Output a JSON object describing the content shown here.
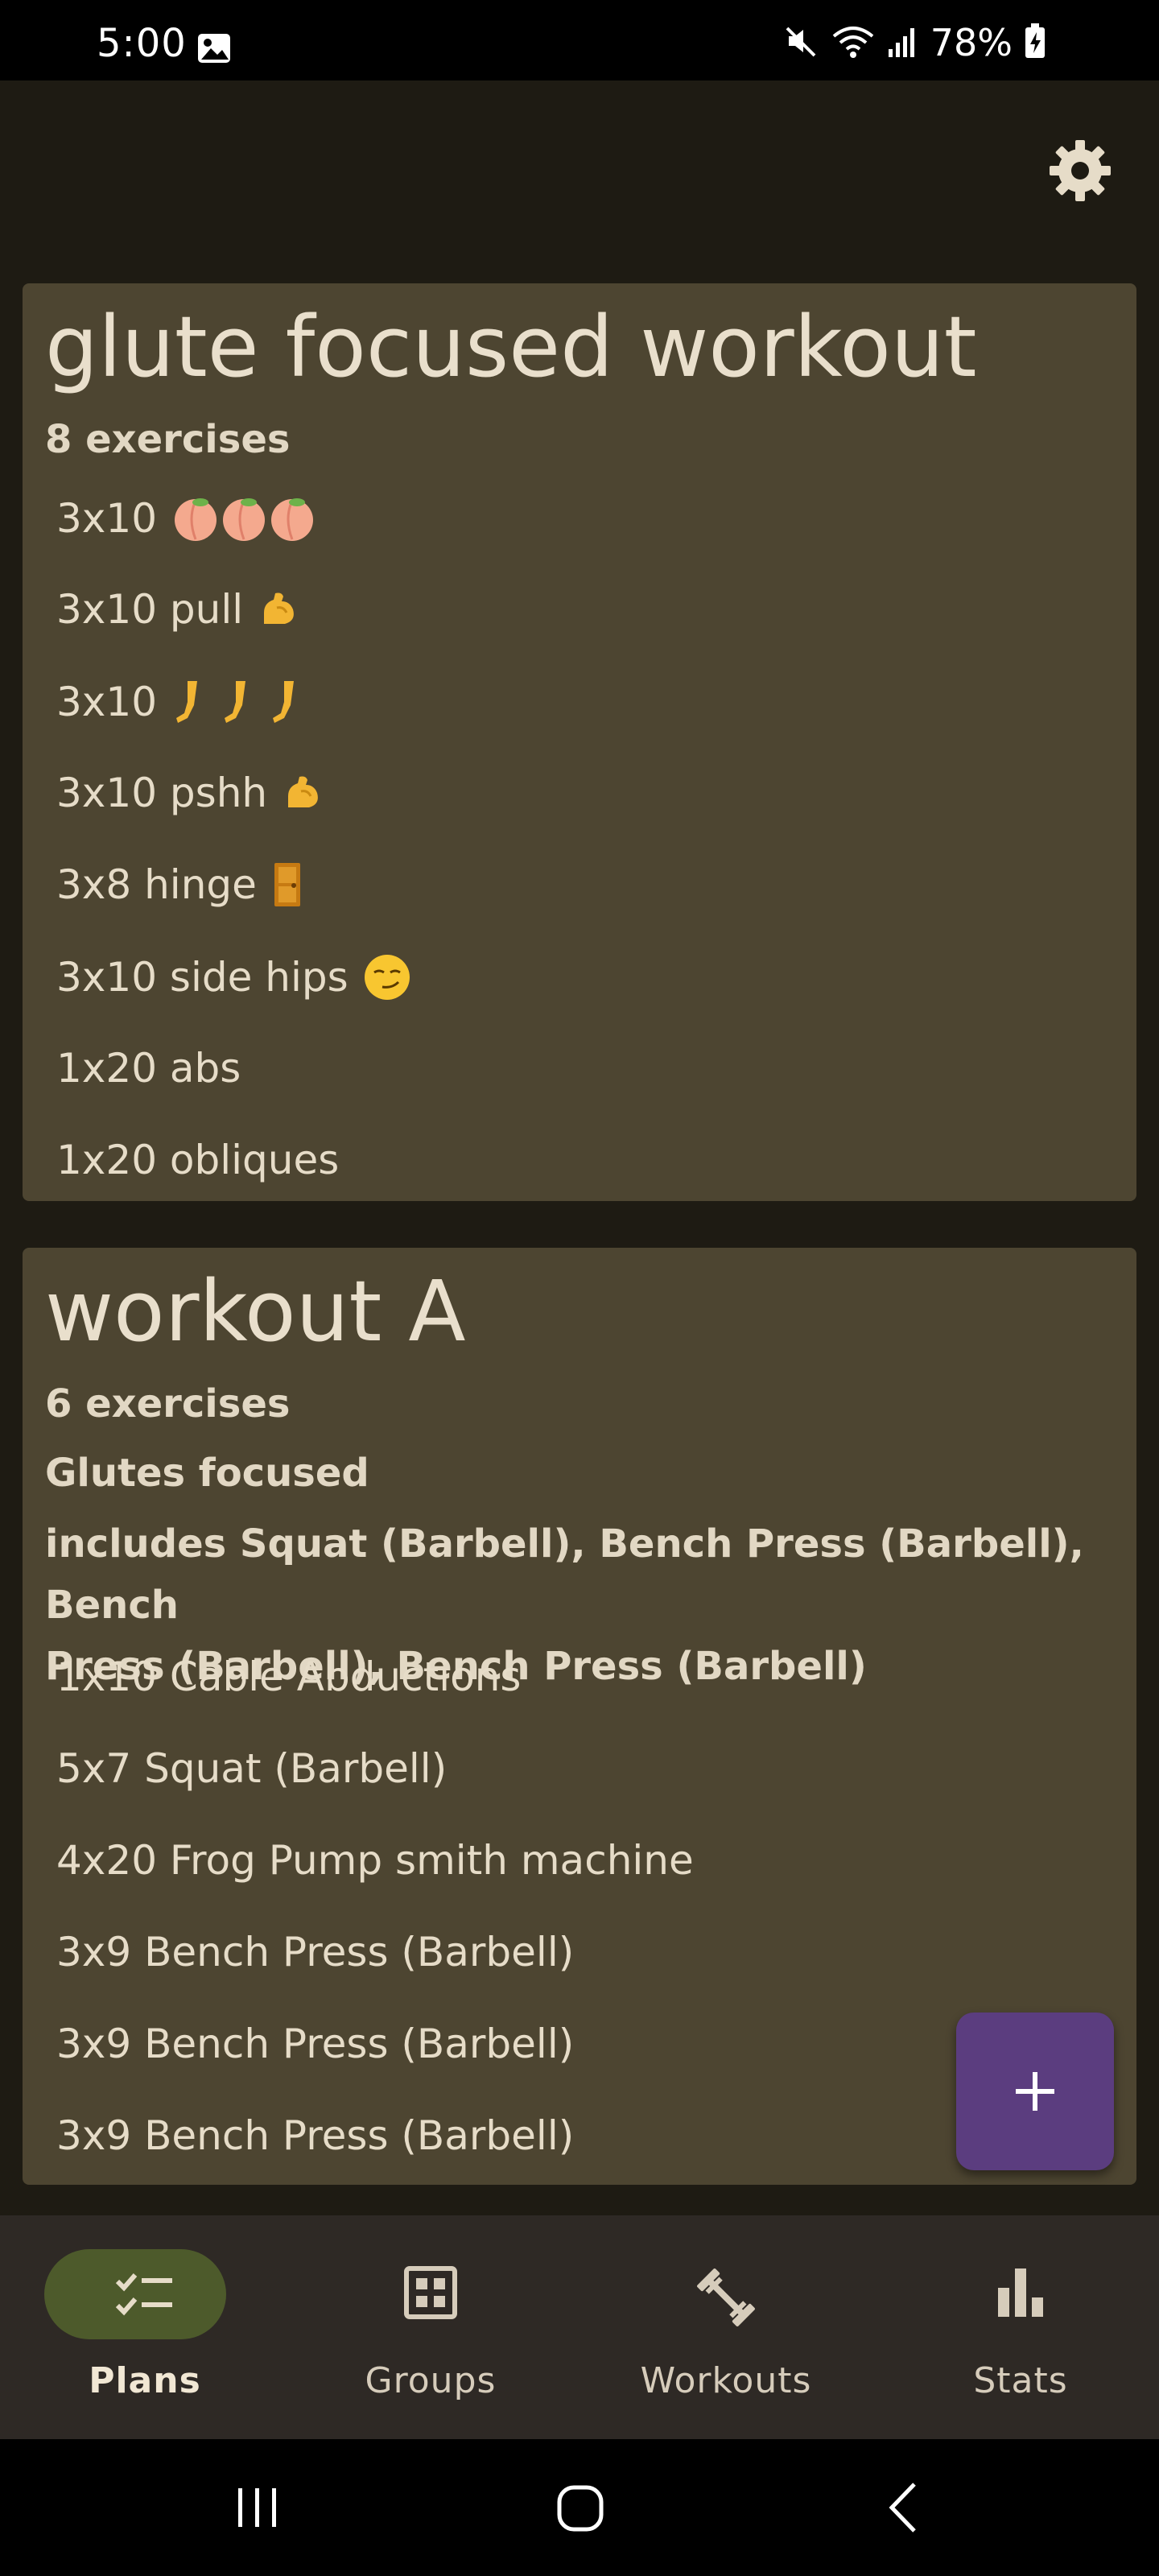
{
  "status_bar": {
    "time": "5:00",
    "battery": "78%"
  },
  "plans": [
    {
      "title": "glute focused workout",
      "count": "8 exercises",
      "exercises": [
        {
          "text": "3x10",
          "icon": "peach"
        },
        {
          "text": "3x10 pull",
          "icon": "flexed-biceps"
        },
        {
          "text": "3x10",
          "icon": "leg"
        },
        {
          "text": "3x10 pshh",
          "icon": "flexed-biceps"
        },
        {
          "text": "3x8 hinge",
          "icon": "door"
        },
        {
          "text": "3x10 side hips",
          "icon": "smirking-face"
        },
        {
          "text": "1x20 abs"
        },
        {
          "text": "1x20 obliques"
        }
      ]
    },
    {
      "title": "workout A",
      "count": "6 exercises",
      "group": "Glutes focused",
      "includes_line1": "includes Squat (Barbell), Bench Press (Barbell), Bench",
      "includes_line2": "Press (Barbell), Bench Press (Barbell)",
      "exercises": [
        {
          "text": "1x10 Cable Abductions"
        },
        {
          "text": "5x7 Squat (Barbell)"
        },
        {
          "text": "4x20 Frog Pump smith machine"
        },
        {
          "text": "3x9 Bench Press (Barbell)"
        },
        {
          "text": "3x9 Bench Press (Barbell)"
        },
        {
          "text": "3x9 Bench Press (Barbell)"
        }
      ]
    }
  ],
  "fab": {
    "icon": "plus-icon"
  },
  "bottom_nav": {
    "active": "plans",
    "items": [
      {
        "label": "Plans",
        "icon": "checklist-icon"
      },
      {
        "label": "Groups",
        "icon": "grid-icon"
      },
      {
        "label": "Workouts",
        "icon": "dumbbell-icon"
      },
      {
        "label": "Stats",
        "icon": "bar-chart-icon"
      }
    ]
  },
  "colors": {
    "background": "#1e1b13",
    "card": "#4d4531",
    "fab": "#5b3d7f",
    "nav_bar": "#2e2925",
    "nav_active_pill": "#4d5a2b",
    "text": "#e6dcc8"
  }
}
